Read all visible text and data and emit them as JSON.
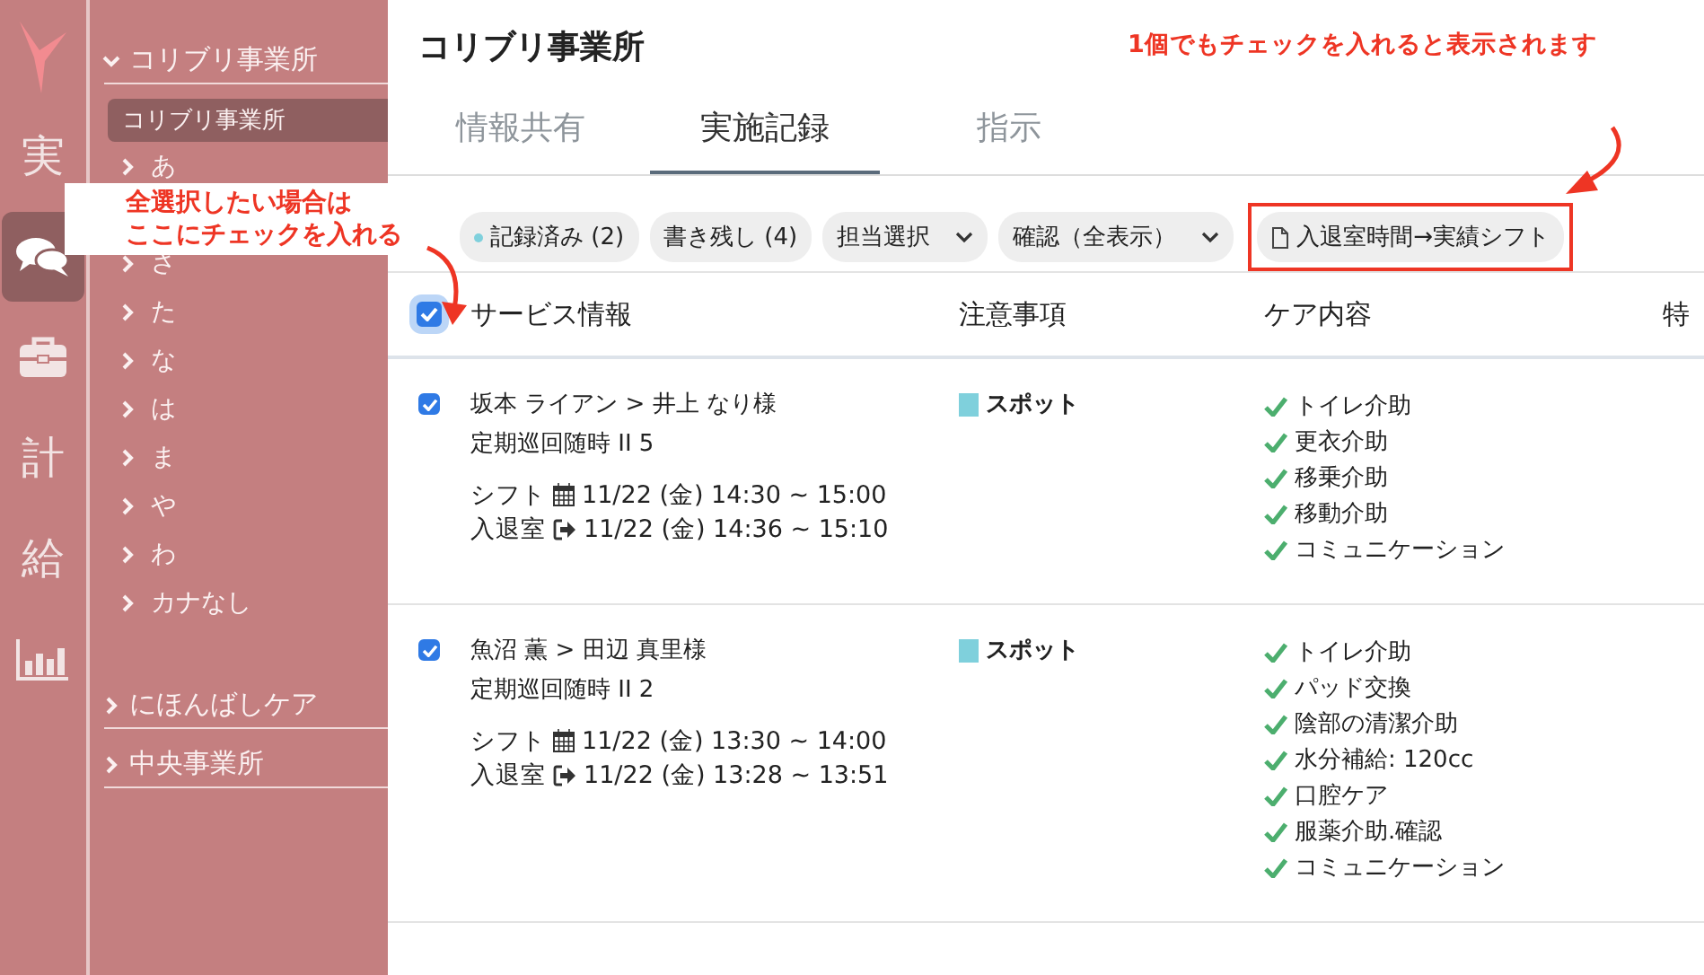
{
  "rail": [
    {
      "kind": "logo"
    },
    {
      "kind": "text",
      "label": "実",
      "selected": false
    },
    {
      "kind": "chat",
      "selected": true
    },
    {
      "kind": "briefcase",
      "selected": false
    },
    {
      "kind": "text",
      "label": "計",
      "selected": false
    },
    {
      "kind": "text",
      "label": "給",
      "selected": false
    },
    {
      "kind": "chart",
      "selected": false
    }
  ],
  "sidebar": {
    "groups": [
      {
        "label": "コリブリ事業所",
        "expanded": true,
        "children": [
          {
            "label": "コリブリ事業所",
            "kind": "office",
            "selected": true
          },
          {
            "label": "あ",
            "kind": "kana",
            "selected": false
          },
          {
            "label": "さ",
            "kind": "kana",
            "selected": false
          },
          {
            "label": "た",
            "kind": "kana",
            "selected": false
          },
          {
            "label": "な",
            "kind": "kana",
            "selected": false
          },
          {
            "label": "は",
            "kind": "kana",
            "selected": false
          },
          {
            "label": "ま",
            "kind": "kana",
            "selected": false
          },
          {
            "label": "や",
            "kind": "kana",
            "selected": false
          },
          {
            "label": "わ",
            "kind": "kana",
            "selected": false
          },
          {
            "label": "カナなし",
            "kind": "kana",
            "selected": false
          }
        ]
      },
      {
        "label": "にほんばしケア",
        "expanded": false
      },
      {
        "label": "中央事業所",
        "expanded": false
      }
    ]
  },
  "main": {
    "title": "コリブリ事業所",
    "tabs": [
      {
        "label": "情報共有",
        "selected": false
      },
      {
        "label": "実施記録",
        "selected": true
      },
      {
        "label": "指示",
        "selected": false
      }
    ],
    "filters": [
      {
        "kind": "status",
        "label": "記録済み (2)",
        "color": "#7fd0dc"
      },
      {
        "kind": "chip",
        "label": "書き残し (4)"
      },
      {
        "kind": "select",
        "label": "担当選択"
      },
      {
        "kind": "select",
        "label": "確認（全表示）"
      },
      {
        "kind": "action",
        "label": "入退室時間→実績シフト",
        "highlighted": true
      }
    ],
    "table": {
      "all_checked": true,
      "columns": [
        "サービス情報",
        "注意事項",
        "ケア内容",
        "特"
      ],
      "rows": [
        {
          "checked": true,
          "title": "坂本 ライアン > 井上 なり様",
          "service": "定期巡回随時 II 5",
          "shift_label": "シフト",
          "shift": "11/22 (金) 14:30 ~ 15:00",
          "visit_label": "入退室",
          "visit": "11/22 (金) 14:36 ~ 15:10",
          "note": {
            "label": "スポット",
            "color": "#7fd0dc"
          },
          "care": [
            "トイレ介助",
            "更衣介助",
            "移乗介助",
            "移動介助",
            "コミュニケーション"
          ]
        },
        {
          "checked": true,
          "title": "魚沼 薫 > 田辺 真里様",
          "service": "定期巡回随時 II 2",
          "shift_label": "シフト",
          "shift": "11/22 (金) 13:30 ~ 14:00",
          "visit_label": "入退室",
          "visit": "11/22 (金) 13:28 ~ 13:51",
          "note": {
            "label": "スポット",
            "color": "#7fd0dc"
          },
          "care": [
            "トイレ介助",
            "パッド交換",
            "陰部の清潔介助",
            "水分補給: 120cc",
            "口腔ケア",
            "服薬介助.確認",
            "コミュニケーション"
          ]
        }
      ]
    }
  },
  "callouts": [
    {
      "lines": [
        "全選択したい場合は",
        "ここにチェックを入れる"
      ]
    },
    {
      "lines": [
        "1個でもチェックを入れると表示されます"
      ]
    }
  ]
}
